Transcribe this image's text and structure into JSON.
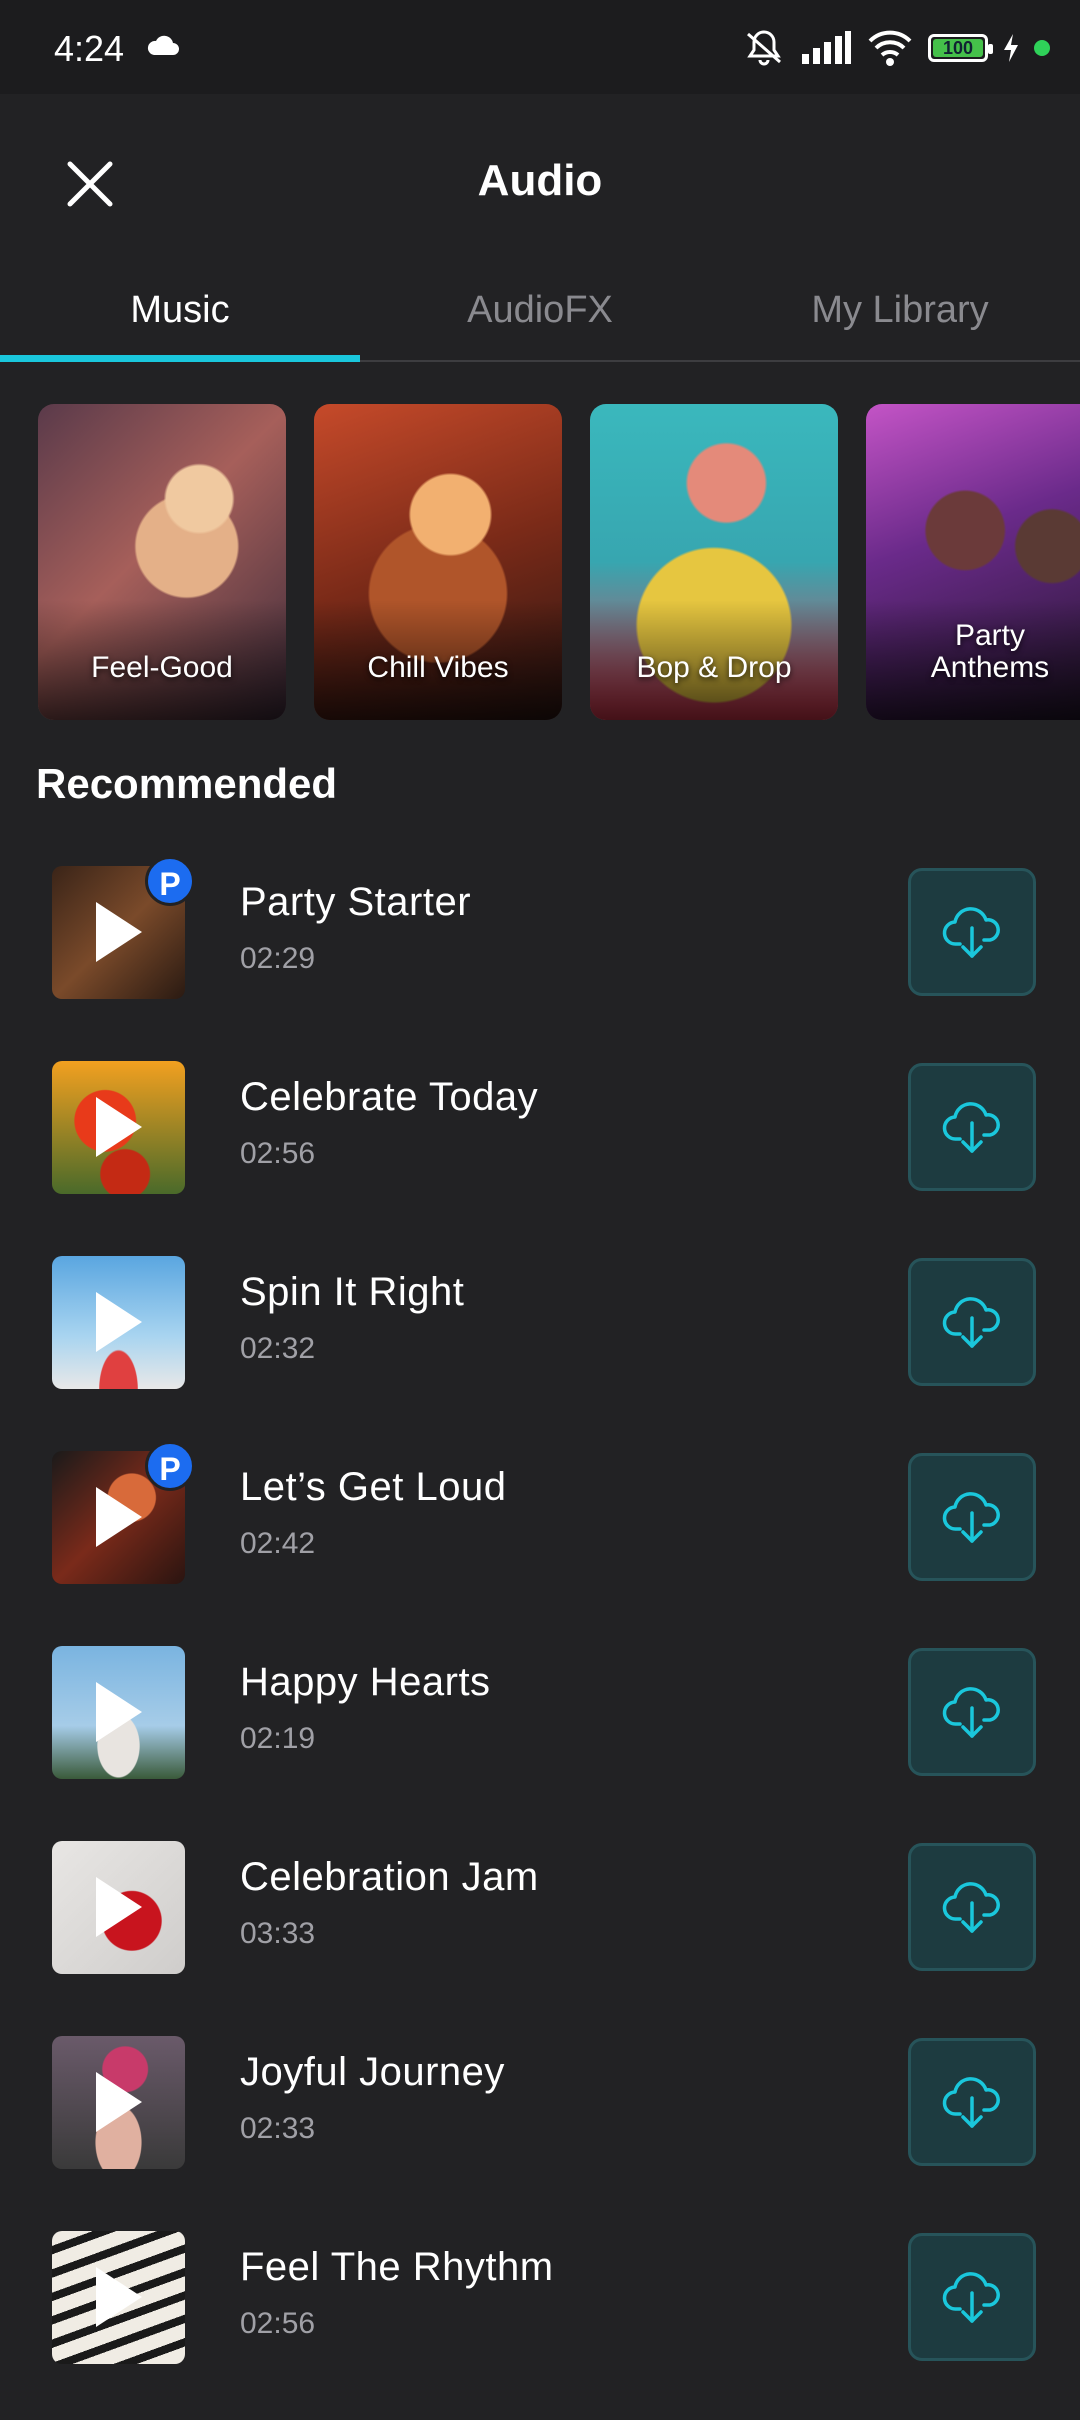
{
  "status_bar": {
    "time": "4:24",
    "battery_level": "100",
    "icons": [
      "cloud-icon",
      "silent-icon",
      "signal-icon",
      "wifi-icon",
      "battery-icon",
      "charging-icon"
    ]
  },
  "header": {
    "title": "Audio",
    "close_icon": "close-icon"
  },
  "tabs": [
    {
      "label": "Music",
      "active": true
    },
    {
      "label": "AudioFX",
      "active": false
    },
    {
      "label": "My Library",
      "active": false
    }
  ],
  "categories": [
    {
      "label": "Feel-Good"
    },
    {
      "label": "Chill Vibes"
    },
    {
      "label": "Bop & Drop"
    },
    {
      "label": "Party\nAnthems"
    }
  ],
  "section_title": "Recommended",
  "tracks": [
    {
      "title": "Party Starter",
      "duration": "02:29",
      "premium": "P"
    },
    {
      "title": "Celebrate Today",
      "duration": "02:56"
    },
    {
      "title": "Spin It Right",
      "duration": "02:32"
    },
    {
      "title": "Let’s Get Loud",
      "duration": "02:42",
      "premium": "P"
    },
    {
      "title": "Happy Hearts",
      "duration": "02:19"
    },
    {
      "title": "Celebration Jam",
      "duration": "03:33"
    },
    {
      "title": "Joyful Journey",
      "duration": "02:33"
    },
    {
      "title": "Feel The Rhythm",
      "duration": "02:56"
    }
  ],
  "colors": {
    "background": "#222224",
    "accent": "#1ac7dc",
    "download_bg": "#1d3b40",
    "premium_badge": "#1c6cf0"
  }
}
